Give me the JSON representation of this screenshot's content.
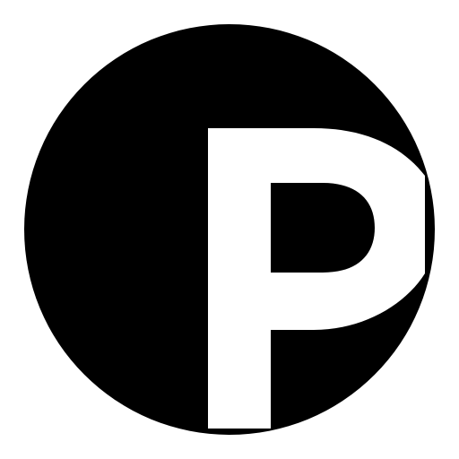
{
  "icon": "p-letter-logo-icon",
  "colors": {
    "background": "#ffffff",
    "circle": "#000000",
    "letter": "#ffffff"
  },
  "logo": {
    "letter": "P"
  }
}
